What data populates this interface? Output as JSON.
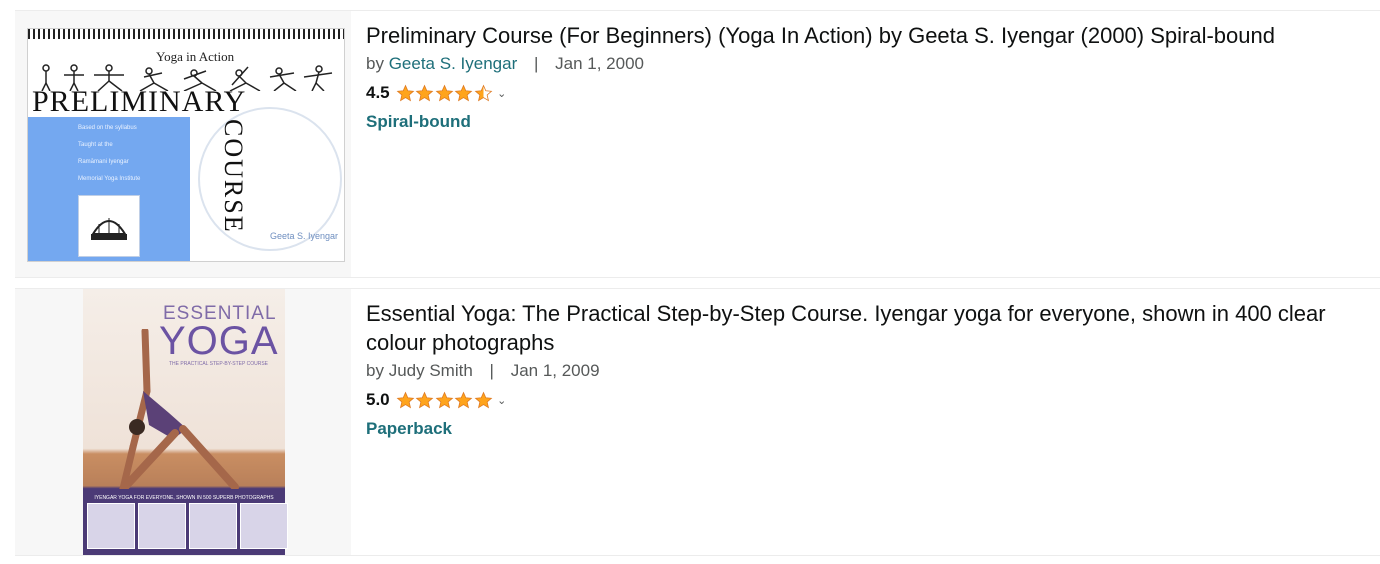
{
  "results": [
    {
      "title": "Preliminary Course (For Beginners) (Yoga In Action) by Geeta S. Iyengar (2000) Spiral-bound",
      "by": "by",
      "author": "Geeta S. Iyengar",
      "separator": "|",
      "date": "Jan 1, 2000",
      "rating": "4.5",
      "format": "Spiral-bound",
      "cover": {
        "small": "Yoga in Action",
        "big": "PRELIMINARY",
        "side": "COURSE",
        "blue_lines": [
          "Based on the syllabus",
          "Taught at the",
          "Ramāmani Iyengar",
          "Memorial Yoga Institute"
        ],
        "author": "Geeta S. Iyengar"
      }
    },
    {
      "title": "Essential Yoga: The Practical Step-by-Step Course. Iyengar yoga for everyone, shown in 400 clear colour photographs",
      "by": "by",
      "author": "Judy Smith",
      "separator": "|",
      "date": "Jan 1, 2009",
      "rating": "5.0",
      "format": "Paperback",
      "cover": {
        "top": "ESSENTIAL",
        "big": "YOGA",
        "sub": "THE PRACTICAL STEP-BY-STEP COURSE",
        "band": "IYENGAR YOGA FOR EVERYONE, SHOWN IN 500 SUPERB PHOTOGRAPHS"
      }
    }
  ],
  "colors": {
    "link": "#1e6f7a",
    "star": "#ffa41c",
    "text": "#0f1111",
    "muted": "#565959"
  },
  "icons": {
    "star_full": "star-icon",
    "star_half": "star-half-icon",
    "dropdown": "chevron-down-icon"
  }
}
